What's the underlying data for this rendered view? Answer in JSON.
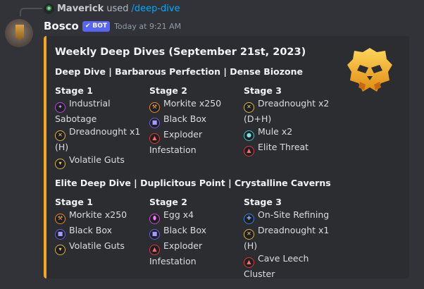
{
  "reply": {
    "username": "Maverick",
    "used_text": "used",
    "command": "/deep-dive"
  },
  "message": {
    "username": "Bosco",
    "badge": "BOT",
    "timestamp": "Today at 9:21 AM"
  },
  "embed": {
    "accent_color": "#f5a623",
    "title": "Weekly Deep Dives (September 21st, 2023)",
    "thumbnail_icon": "drg-skull-emblem-icon",
    "sections": [
      {
        "title": "Deep Dive | Barbarous Perfection | Dense Biozone",
        "stages": [
          {
            "title": "Stage 1",
            "items": [
              {
                "icon": "industrial-sabotage-icon",
                "color": "purple",
                "text": "Industrial Sabotage"
              },
              {
                "icon": "dreadnought-icon",
                "color": "gold",
                "text": "Dreadnought x1 (H)"
              },
              {
                "icon": "volatile-guts-icon",
                "color": "gold",
                "text": "Volatile Guts"
              }
            ]
          },
          {
            "title": "Stage 2",
            "items": [
              {
                "icon": "pickaxe-icon",
                "color": "orange",
                "text": "Morkite x250"
              },
              {
                "icon": "black-box-icon",
                "color": "indigo",
                "text": "Black Box"
              },
              {
                "icon": "warning-icon",
                "color": "red",
                "text": "Exploder Infestation"
              }
            ]
          },
          {
            "title": "Stage 3",
            "items": [
              {
                "icon": "dreadnought-icon",
                "color": "gold",
                "text": "Dreadnought x2 (D+H)"
              },
              {
                "icon": "mule-icon",
                "color": "teal",
                "text": "Mule x2"
              },
              {
                "icon": "warning-icon",
                "color": "red",
                "text": "Elite Threat"
              }
            ]
          }
        ]
      },
      {
        "title": "Elite Deep Dive | Duplicitous Point | Crystalline Caverns",
        "stages": [
          {
            "title": "Stage 1",
            "items": [
              {
                "icon": "pickaxe-icon",
                "color": "orange",
                "text": "Morkite x250"
              },
              {
                "icon": "black-box-icon",
                "color": "indigo",
                "text": "Black Box"
              },
              {
                "icon": "volatile-guts-icon",
                "color": "gold",
                "text": "Volatile Guts"
              }
            ]
          },
          {
            "title": "Stage 2",
            "items": [
              {
                "icon": "egg-icon",
                "color": "magenta",
                "text": "Egg x4"
              },
              {
                "icon": "black-box-icon",
                "color": "indigo",
                "text": "Black Box"
              },
              {
                "icon": "warning-icon",
                "color": "red",
                "text": "Exploder Infestation"
              }
            ]
          },
          {
            "title": "Stage 3",
            "items": [
              {
                "icon": "on-site-refining-icon",
                "color": "blue",
                "text": "On-Site Refining"
              },
              {
                "icon": "dreadnought-icon",
                "color": "gold",
                "text": "Dreadnought x1 (H)"
              },
              {
                "icon": "warning-icon",
                "color": "red",
                "text": "Cave Leech Cluster"
              }
            ]
          }
        ]
      }
    ]
  }
}
